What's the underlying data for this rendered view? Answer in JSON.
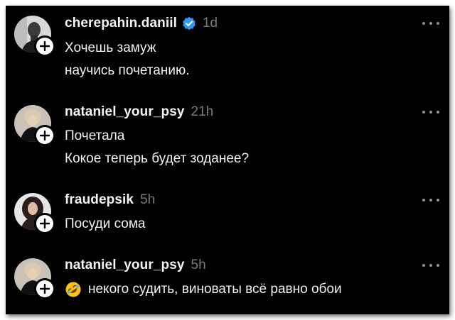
{
  "comments": [
    {
      "username": "cherepahin.daniil",
      "verified": true,
      "time": "1d",
      "lines": [
        "Хочешь замуж",
        "научись почетанию."
      ],
      "avatar": "avatar-man"
    },
    {
      "username": "nataniel_your_psy",
      "verified": false,
      "time": "21h",
      "lines": [
        "Почетала",
        "Кокое теперь будет зоданее?"
      ],
      "avatar": "avatar-woman-blonde"
    },
    {
      "username": "fraudepsik",
      "verified": false,
      "time": "5h",
      "lines": [
        "Посуди сома"
      ],
      "avatar": "avatar-woman-dark"
    },
    {
      "username": "nataniel_your_psy",
      "verified": false,
      "time": "5h",
      "lines": [
        "некого судить, виноваты всё равно обои"
      ],
      "emoji": "rolling-on-floor-laughing-emoji",
      "avatar": "avatar-woman-blonde"
    }
  ],
  "icons": {
    "verified": "verified-badge-icon",
    "follow": "plus-icon",
    "more": "more-options-icon"
  },
  "colors": {
    "background": "#000000",
    "text": "#f2f2f2",
    "muted": "#7a7a7a",
    "verified": "#3897f0"
  }
}
